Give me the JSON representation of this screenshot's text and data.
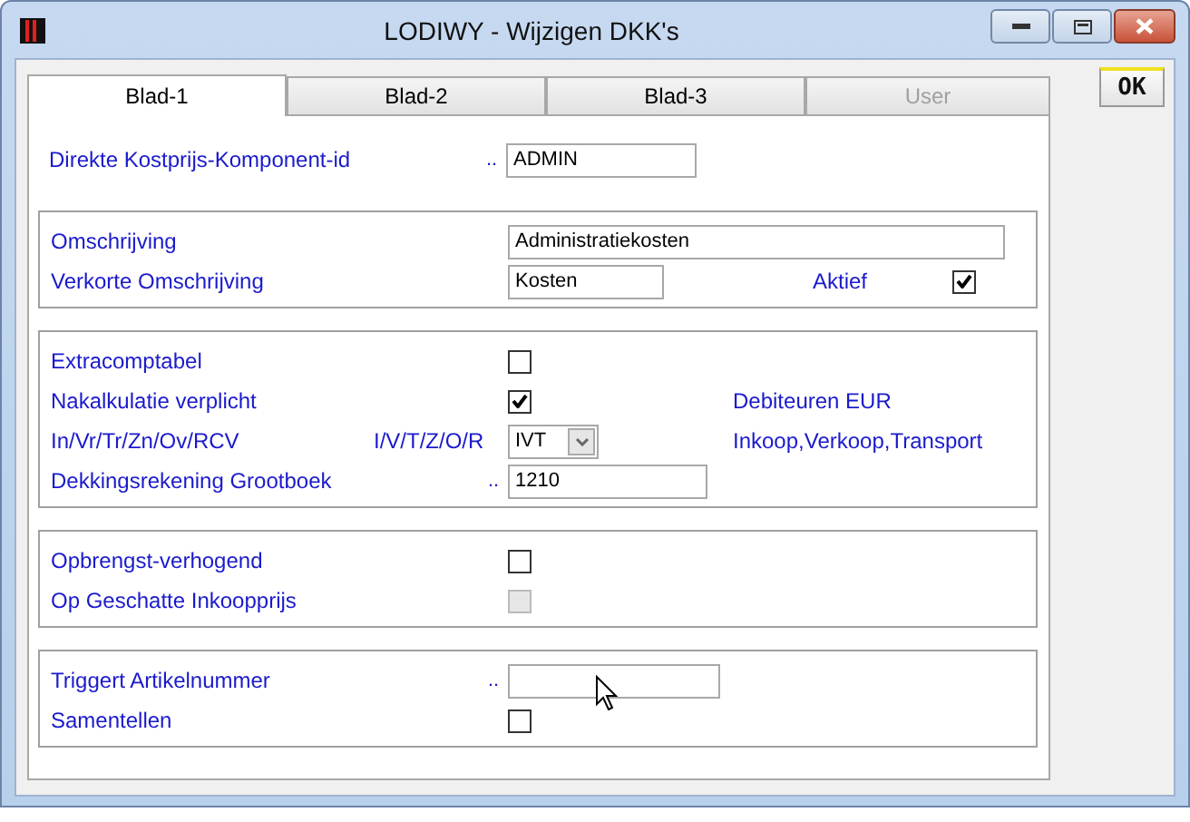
{
  "window": {
    "title": "LODIWY - Wijzigen DKK's"
  },
  "tabs": [
    {
      "label": "Blad-1",
      "selected": true,
      "disabled": false
    },
    {
      "label": "Blad-2",
      "selected": false,
      "disabled": false
    },
    {
      "label": "Blad-3",
      "selected": false,
      "disabled": false
    },
    {
      "label": "User",
      "selected": false,
      "disabled": true
    }
  ],
  "ok_button": "OK",
  "groups": [
    {
      "boxed": false,
      "rows": [
        {
          "kind": "text",
          "label": "Direkte Kostprijs-Komponent-id",
          "dots": "..",
          "value": "ADMIN"
        }
      ]
    },
    {
      "boxed": true,
      "rows": [
        {
          "kind": "text",
          "label": "Omschrijving",
          "value": "Administratiekosten"
        },
        {
          "kind": "text",
          "label": "Verkorte Omschrijving",
          "value": "Kosten",
          "extra": {
            "label": "Aktief",
            "checked": true
          }
        }
      ]
    },
    {
      "boxed": true,
      "rows": [
        {
          "kind": "check",
          "label": "Extracomptabel",
          "checked": false,
          "disabled": false
        },
        {
          "kind": "check",
          "label": "Nakalkulatie verplicht",
          "checked": true,
          "disabled": false,
          "note": "Debiteuren EUR"
        },
        {
          "kind": "select",
          "label": "In/Vr/Tr/Zn/Ov/RCV",
          "sublabel": "I/V/T/Z/O/R",
          "value": "IVT",
          "note": "Inkoop,Verkoop,Transport"
        },
        {
          "kind": "text",
          "label": "Dekkingsrekening Grootboek",
          "dots": "..",
          "value": "1210"
        }
      ]
    },
    {
      "boxed": true,
      "rows": [
        {
          "kind": "check",
          "label": "Opbrengst-verhogend",
          "checked": false,
          "disabled": false
        },
        {
          "kind": "check",
          "label": "Op Geschatte Inkoopprijs",
          "checked": false,
          "disabled": true
        }
      ]
    },
    {
      "boxed": true,
      "rows": [
        {
          "kind": "text",
          "label": "Triggert Artikelnummer",
          "dots": ".."
        },
        {
          "kind": "check",
          "label": "Samentellen",
          "checked": false,
          "disabled": false
        }
      ]
    }
  ]
}
